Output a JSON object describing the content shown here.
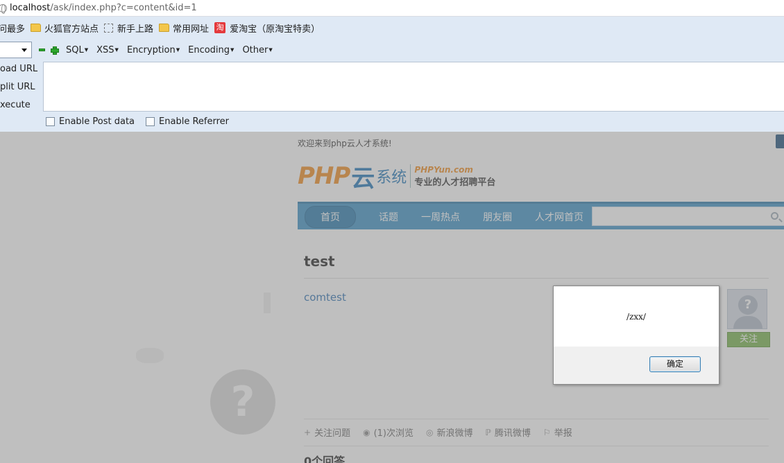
{
  "browser": {
    "url_host": "localhost",
    "url_rest": "/ask/index.php?c=content&id=1",
    "bookmarks": [
      {
        "label": "问最多",
        "icon": "none"
      },
      {
        "label": "火狐官方站点",
        "icon": "folder-icon"
      },
      {
        "label": "新手上路",
        "icon": "dashed-box-icon"
      },
      {
        "label": "常用网址",
        "icon": "folder-icon"
      },
      {
        "label": "爱淘宝（原淘宝特卖）",
        "icon": "taobao-icon"
      }
    ],
    "taobao_glyph": "淘"
  },
  "hackbar": {
    "menus": [
      "SQL",
      "XSS",
      "Encryption",
      "Encoding",
      "Other"
    ],
    "side": [
      "oad URL",
      "plit URL",
      "xecute"
    ],
    "enable_post": "Enable Post data",
    "enable_referrer": "Enable Referrer"
  },
  "site": {
    "welcome": "欢迎来到php云人才系统!",
    "logo": {
      "php": "PHP",
      "yun": "云",
      "sys": "系统",
      "domain": "PHPYun.com",
      "slogan": "专业的人才招聘平台"
    },
    "nav": [
      "首页",
      "话题",
      "一周热点",
      "朋友圈",
      "人才网首页"
    ]
  },
  "question": {
    "title": "test",
    "author": "comtest",
    "follow": "关注",
    "avatar_glyph": "?",
    "actions": [
      {
        "label": "关注问题",
        "icon": "plus-icon"
      },
      {
        "label": "(1)次浏览",
        "icon": "eye-icon"
      },
      {
        "label": "新浪微博",
        "icon": "weibo-icon"
      },
      {
        "label": "腾讯微博",
        "icon": "tencent-icon"
      },
      {
        "label": "举报",
        "icon": "flag-icon"
      }
    ],
    "answers": "0个回答"
  },
  "dialog": {
    "message": "/zxx/",
    "ok": "确定"
  },
  "deco": {
    "question_glyph": "?"
  }
}
